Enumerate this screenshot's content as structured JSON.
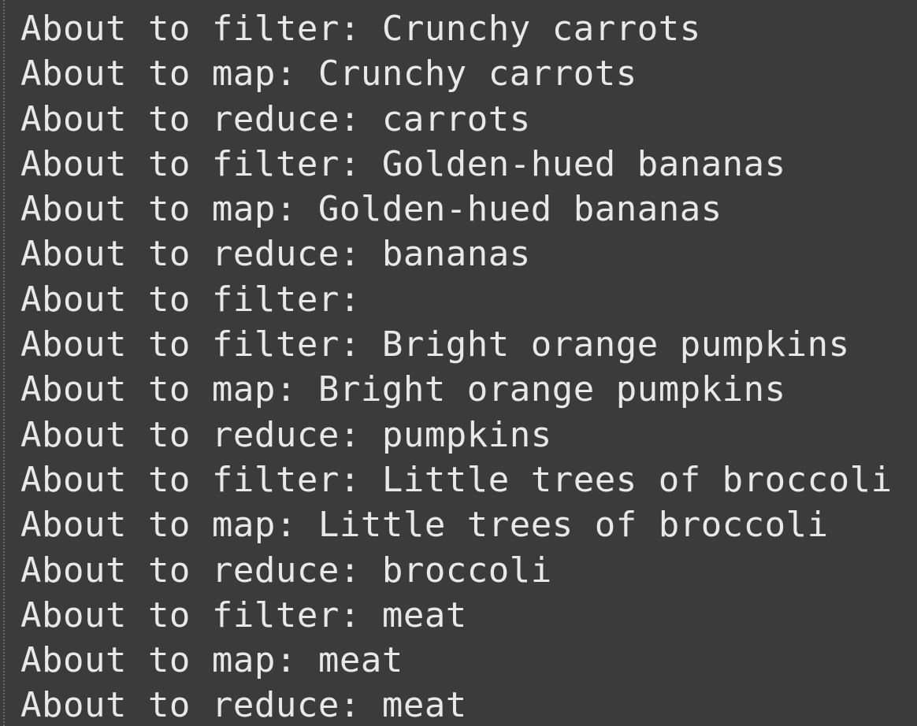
{
  "console": {
    "partial_top_line": "About to reduce: carrots",
    "lines": [
      "About to filter: Crunchy carrots",
      "About to map: Crunchy carrots",
      "About to reduce: carrots",
      "About to filter: Golden-hued bananas",
      "About to map: Golden-hued bananas",
      "About to reduce: bananas",
      "About to filter:",
      "About to filter: Bright orange pumpkins",
      "About to map: Bright orange pumpkins",
      "About to reduce: pumpkins",
      "About to filter: Little trees of broccoli",
      "About to map: Little trees of broccoli",
      "About to reduce: broccoli",
      "About to filter: meat",
      "About to map: meat",
      "About to reduce: meat"
    ]
  },
  "colors": {
    "background": "#3b3b3b",
    "text": "#e8e8e8"
  }
}
